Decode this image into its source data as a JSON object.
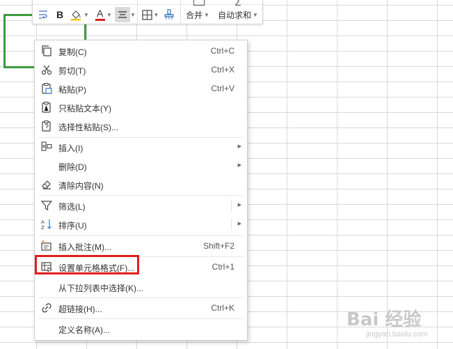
{
  "toolbar": {
    "bold_label": "B",
    "font_color_label": "A",
    "merge_label": "合并",
    "autosum_label": "自动求和"
  },
  "menu": {
    "items": [
      {
        "label": "复制(C)",
        "shortcut": "Ctrl+C",
        "icon": "copy-icon"
      },
      {
        "label": "剪切(T)",
        "shortcut": "Ctrl+X",
        "icon": "scissors-icon"
      },
      {
        "label": "粘贴(P)",
        "shortcut": "Ctrl+V",
        "icon": "paste-icon"
      },
      {
        "label": "只粘贴文本(Y)",
        "shortcut": "",
        "icon": "paste-text-icon"
      },
      {
        "label": "选择性粘贴(S)...",
        "shortcut": "",
        "icon": "paste-special-icon"
      },
      {
        "label": "插入(I)",
        "shortcut": "",
        "icon": "insert-icon"
      },
      {
        "label": "删除(D)",
        "shortcut": "",
        "icon": ""
      },
      {
        "label": "清除内容(N)",
        "shortcut": "",
        "icon": "eraser-icon"
      },
      {
        "label": "筛选(L)",
        "shortcut": "",
        "icon": "filter-icon"
      },
      {
        "label": "排序(U)",
        "shortcut": "",
        "icon": "sort-icon"
      },
      {
        "label": "插入批注(M)...",
        "shortcut": "Shift+F2",
        "icon": "comment-icon"
      },
      {
        "label": "设置单元格格式(F)...",
        "shortcut": "Ctrl+1",
        "icon": "format-cells-icon"
      },
      {
        "label": "从下拉列表中选择(K)...",
        "shortcut": "",
        "icon": ""
      },
      {
        "label": "超链接(H)...",
        "shortcut": "Ctrl+K",
        "icon": "link-icon"
      },
      {
        "label": "定义名称(A)...",
        "shortcut": "",
        "icon": ""
      }
    ]
  },
  "watermark": {
    "text": "Bai 经验",
    "sub": "jingyan.baidu.com"
  },
  "colors": {
    "selection_border": "#3d9a3d",
    "highlight": "#e41e1e",
    "font_color_bar": "#e02020"
  }
}
